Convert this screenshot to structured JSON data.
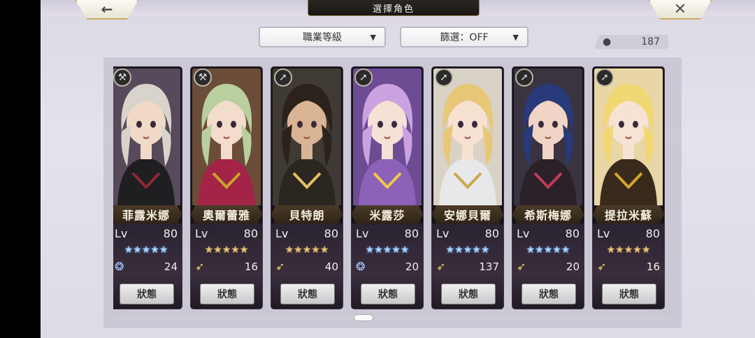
{
  "header": {
    "title": "選擇角色",
    "back_label": "←",
    "close_label": "✕"
  },
  "filters": {
    "sort_label": "職業等級",
    "filter_label": "篩選：OFF",
    "caret": "▼"
  },
  "count": {
    "icon": "user-icon",
    "value": "187"
  },
  "cards": [
    {
      "name": "菲露米娜",
      "lv_label": "Lv",
      "level": "80",
      "stars": "★★★★★",
      "star_color": "blue",
      "res_icon": "swirl",
      "res_glyph": "❂",
      "res_value": "24",
      "status": "狀態",
      "class_glyph": "⚒",
      "hair": "#d8d4cc",
      "bg": "#574a5a",
      "skin": "#f1d9c8",
      "cloth": "#1f1f22",
      "accent": "#8b2a36"
    },
    {
      "name": "奧爾蕾雅",
      "lv_label": "Lv",
      "level": "80",
      "stars": "★★★★★",
      "star_color": "gold",
      "res_icon": "wing",
      "res_glyph": "➶",
      "res_value": "16",
      "status": "狀態",
      "class_glyph": "⚒",
      "hair": "#b9cf9e",
      "bg": "#6b4d3a",
      "skin": "#f3dccb",
      "cloth": "#a32447",
      "accent": "#c9a52a"
    },
    {
      "name": "貝特朗",
      "lv_label": "Lv",
      "level": "80",
      "stars": "★★★★★",
      "star_color": "gold",
      "res_icon": "wing",
      "res_glyph": "➶",
      "res_value": "40",
      "status": "狀態",
      "class_glyph": "➚",
      "hair": "#2b221b",
      "bg": "#3f3a33",
      "skin": "#d9b494",
      "cloth": "#2c2621",
      "accent": "#e3c065"
    },
    {
      "name": "米露莎",
      "lv_label": "Lv",
      "level": "80",
      "stars": "★★★★★",
      "star_color": "blue",
      "res_icon": "swirl",
      "res_glyph": "❂",
      "res_value": "20",
      "status": "狀態",
      "class_glyph": "➚",
      "hair": "#c9a2df",
      "bg": "#6d4c94",
      "skin": "#f6e1d6",
      "cloth": "#8b62b8",
      "accent": "#f2c74a"
    },
    {
      "name": "安娜貝爾",
      "lv_label": "Lv",
      "level": "80",
      "stars": "★★★★★",
      "star_color": "blue",
      "res_icon": "wing",
      "res_glyph": "➶",
      "res_value": "137",
      "status": "狀態",
      "class_glyph": "➚",
      "hair": "#e8c878",
      "bg": "#d9d2c6",
      "skin": "#f7e2d2",
      "cloth": "#e8e8ea",
      "accent": "#c9a84e"
    },
    {
      "name": "希斯梅娜",
      "lv_label": "Lv",
      "level": "80",
      "stars": "★★★★★",
      "star_color": "blue",
      "res_icon": "wing",
      "res_glyph": "➶",
      "res_value": "20",
      "status": "狀態",
      "class_glyph": "➚",
      "hair": "#283a7a",
      "bg": "#3a3340",
      "skin": "#f0d4c6",
      "cloth": "#2a2228",
      "accent": "#c23a58"
    },
    {
      "name": "提拉米蘇",
      "lv_label": "Lv",
      "level": "80",
      "stars": "★★★★★",
      "star_color": "gold",
      "res_icon": "wing",
      "res_glyph": "➶",
      "res_value": "16",
      "status": "狀態",
      "class_glyph": "➚",
      "hair": "#f1d772",
      "bg": "#e9d6a6",
      "skin": "#f7e3d3",
      "cloth": "#3a2a1c",
      "accent": "#d4a62a"
    }
  ]
}
